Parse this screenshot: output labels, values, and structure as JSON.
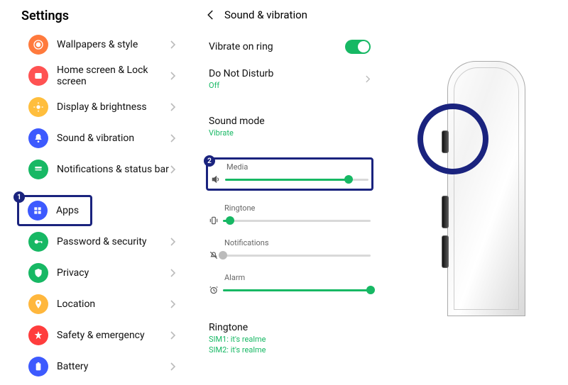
{
  "settings_title": "Settings",
  "settings_items": [
    {
      "label": "Wallpapers & style",
      "color": "#ff7a3d"
    },
    {
      "label": "Home screen & Lock screen",
      "color": "#ff5252"
    },
    {
      "label": "Display & brightness",
      "color": "#ffbe3d"
    },
    {
      "label": "Sound & vibration",
      "color": "#3d5afe"
    },
    {
      "label": "Notifications & status bar",
      "color": "#17b864"
    }
  ],
  "settings_items_2": [
    {
      "label": "Apps",
      "color": "#3d5afe",
      "highlighted": true,
      "badge": "1"
    },
    {
      "label": "Password & security",
      "color": "#17b864"
    },
    {
      "label": "Privacy",
      "color": "#17b864"
    },
    {
      "label": "Location",
      "color": "#ffb73d"
    },
    {
      "label": "Safety & emergency",
      "color": "#ff3d3d"
    },
    {
      "label": "Battery",
      "color": "#3d5afe"
    }
  ],
  "sound_vibration": {
    "title": "Sound & vibration",
    "vibrate_on_ring": {
      "label": "Vibrate on ring",
      "on": true
    },
    "dnd": {
      "label": "Do Not Disturb",
      "sub": "Off"
    },
    "sound_mode": {
      "label": "Sound mode",
      "sub": "Vibrate"
    },
    "sliders": {
      "media": {
        "name": "Media",
        "value": 86,
        "badge": "2"
      },
      "ringtone": {
        "name": "Ringtone",
        "value": 5
      },
      "notifications": {
        "name": "Notifications",
        "value": 0
      },
      "alarm": {
        "name": "Alarm",
        "value": 100
      }
    },
    "ringtone": {
      "label": "Ringtone",
      "sim1": "SIM1: it's realme",
      "sim2": "SIM2: it's realme"
    }
  },
  "colors": {
    "accent": "#17b864",
    "highlight": "#1a237e"
  }
}
